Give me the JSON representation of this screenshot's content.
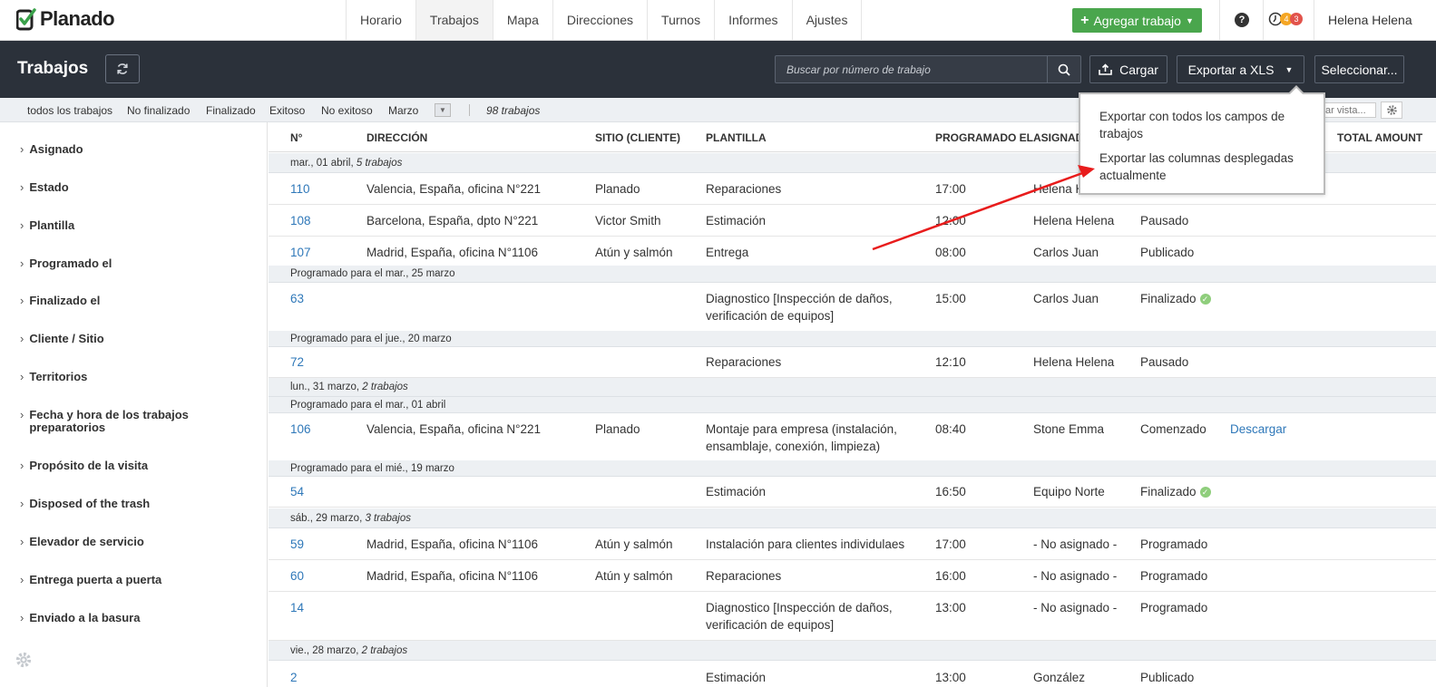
{
  "app": {
    "logo_text": "Planado"
  },
  "nav": {
    "tabs": [
      "Horario",
      "Trabajos",
      "Mapa",
      "Direcciones",
      "Turnos",
      "Informes",
      "Ajustes"
    ],
    "active_tab": "Trabajos",
    "add_job_label": "Agregar trabajo",
    "help_label": "?",
    "badges": [
      "4",
      "3"
    ],
    "user_name": "Helena Helena"
  },
  "header": {
    "title": "Trabajos",
    "search_placeholder": "Buscar por número de trabajo",
    "upload_label": "Cargar",
    "export_label": "Exportar a XLS",
    "select_label": "Seleccionar..."
  },
  "export_menu": {
    "items": [
      "Exportar con todos los campos de trabajos",
      "Exportar las columnas desplegadas actualmente"
    ]
  },
  "filters": {
    "items": [
      "todos los trabajos",
      "No finalizado",
      "Finalizado",
      "Exitoso",
      "No exitoso",
      "Marzo"
    ],
    "count": "98 trabajos",
    "view_placeholder": "ar vista..."
  },
  "sidebar": {
    "items": [
      "Asignado",
      "Estado",
      "Plantilla",
      "Programado el",
      "Finalizado el",
      "Cliente / Sitio",
      "Territorios",
      "Fecha y hora de los trabajos preparatorios",
      "Propósito de la visita",
      "Disposed of the trash",
      "Elevador de servicio",
      "Entrega puerta a puerta",
      "Enviado a la basura"
    ]
  },
  "table": {
    "columns": [
      "N°",
      "DIRECCIÓN",
      "SITIO (CLIENTE)",
      "PLANTILLA",
      "PROGRAMADO EL",
      "ASIGNADO",
      "TOTAL AMOUNT"
    ],
    "groups": [
      {
        "label": "mar., 01 abril,",
        "count": "5 trabajos"
      },
      {
        "label": "Programado para el mar., 25 marzo"
      },
      {
        "label": "Programado para el jue., 20 marzo"
      },
      {
        "label": "lun., 31 marzo,",
        "count": "2 trabajos"
      },
      {
        "label": "Programado para el mar., 01 abril"
      },
      {
        "label": "Programado para el mié., 19 marzo"
      },
      {
        "label": "sáb., 29 marzo,",
        "count": "3 trabajos"
      },
      {
        "label": "vie., 28 marzo,",
        "count": "2 trabajos"
      }
    ],
    "rows": [
      {
        "num": "110",
        "address": "Valencia, España, oficina N°221",
        "site": "Planado",
        "template": "Reparaciones",
        "time": "17:00",
        "assignee": "Helena H",
        "status": "",
        "extra": ""
      },
      {
        "num": "108",
        "address": "Barcelona, España, dpto N°221",
        "site": "Victor Smith",
        "template": "Estimación",
        "time": "12:00",
        "assignee": "Helena Helena",
        "status": "Pausado",
        "extra": ""
      },
      {
        "num": "107",
        "address": "Madrid, España, oficina N°1106",
        "site": "Atún y salmón",
        "template": "Entrega",
        "time": "08:00",
        "assignee": "Carlos Juan",
        "status": "Publicado",
        "extra": ""
      },
      {
        "num": "63",
        "address": "",
        "site": "",
        "template": "Diagnostico [Inspección de daños, verificación de equipos]",
        "time": "15:00",
        "assignee": "Carlos Juan",
        "status": "Finalizado",
        "extra": ""
      },
      {
        "num": "72",
        "address": "",
        "site": "",
        "template": "Reparaciones",
        "time": "12:10",
        "assignee": "Helena Helena",
        "status": "Pausado",
        "extra": ""
      },
      {
        "num": "106",
        "address": "Valencia, España, oficina N°221",
        "site": "Planado",
        "template": "Montaje para empresa (instalación, ensamblaje, conexión, limpieza)",
        "time": "08:40",
        "assignee": "Stone Emma",
        "status": "Comenzado",
        "extra": "Descargar"
      },
      {
        "num": "54",
        "address": "",
        "site": "",
        "template": "Estimación",
        "time": "16:50",
        "assignee": "Equipo Norte",
        "status": "Finalizado",
        "extra": ""
      },
      {
        "num": "59",
        "address": "Madrid, España, oficina N°1106",
        "site": "Atún y salmón",
        "template": "Instalación para clientes individulaes",
        "time": "17:00",
        "assignee": "- No asignado -",
        "status": "Programado",
        "extra": ""
      },
      {
        "num": "60",
        "address": "Madrid, España, oficina N°1106",
        "site": "Atún y salmón",
        "template": "Reparaciones",
        "time": "16:00",
        "assignee": "- No asignado -",
        "status": "Programado",
        "extra": ""
      },
      {
        "num": "14",
        "address": "",
        "site": "",
        "template": "Diagnostico [Inspección de daños, verificación de equipos]",
        "time": "13:00",
        "assignee": "- No asignado -",
        "status": "Programado",
        "extra": ""
      },
      {
        "num": "2",
        "address": "",
        "site": "",
        "template": "Estimación",
        "time": "13:00",
        "assignee": "González",
        "status": "Publicado",
        "extra": ""
      }
    ]
  },
  "colors": {
    "accent_green": "#4aa64d",
    "link_blue": "#2f78b9",
    "header_dark": "#2b313a",
    "badge_orange": "#f5a623",
    "badge_red": "#e2534b",
    "annotation_red": "#e81c1c"
  }
}
